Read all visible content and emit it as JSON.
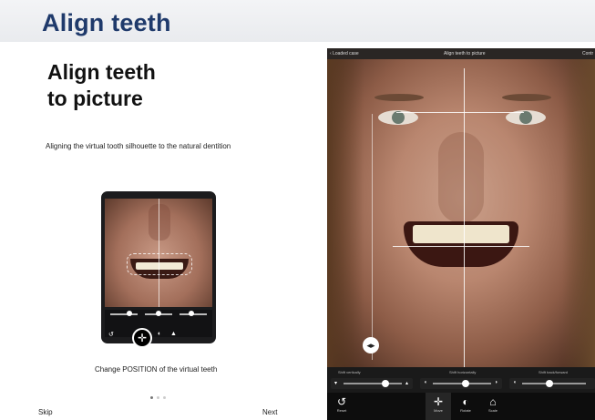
{
  "header": {
    "title": "Align teeth"
  },
  "left": {
    "title_line1": "Align teeth",
    "title_line2": "to picture",
    "subtitle": "Aligning the virtual tooth silhouette to the natural dentition",
    "caption": "Change POSITION of the virtual teeth",
    "pagination": {
      "current": 1,
      "total": 3
    },
    "skip_label": "Skip",
    "next_label": "Next"
  },
  "right": {
    "back_label": "Loaded case",
    "nav_title": "Align teeth to picture",
    "nav_right": "Contr",
    "sliders": [
      {
        "label": "Shift vertically",
        "level": 0.7
      },
      {
        "label": "Shift horizontally",
        "level": 0.55
      },
      {
        "label": "Shift back/forward",
        "level": 0.4
      }
    ],
    "tools": [
      {
        "label": "Reset",
        "icon": "reset-icon"
      },
      {
        "label": "Move",
        "icon": "move-icon"
      },
      {
        "label": "Rotate",
        "icon": "rotate-icon"
      },
      {
        "label": "Scale",
        "icon": "scale-icon"
      }
    ]
  },
  "colors": {
    "header_title": "#1f3a6b",
    "header_bg": "#eceef1",
    "app_dark": "#0d0d0d"
  }
}
